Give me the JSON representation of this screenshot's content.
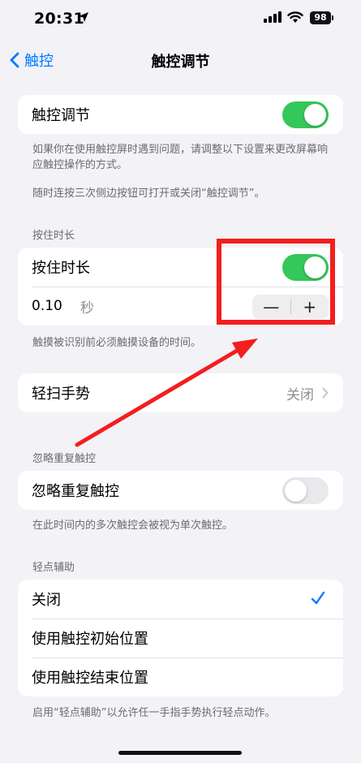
{
  "status": {
    "time": "20:31",
    "battery": "98"
  },
  "nav": {
    "back_label": "触控",
    "title": "触控调节"
  },
  "touch_accommodations": {
    "label": "触控调节",
    "enabled": true,
    "footnote_1": "如果你在使用触控屏时遇到问题，请调整以下设置来更改屏幕响应触控操作的方式。",
    "footnote_2": "随时连按三次侧边按钮可打开或关闭“触控调节”。"
  },
  "hold_duration": {
    "header": "按住时长",
    "label": "按住时长",
    "enabled": true,
    "value": "0.10",
    "unit": "秒",
    "minus": "—",
    "plus": "+",
    "footnote": "触摸被识别前必须触摸设备的时间。"
  },
  "swipe_gestures": {
    "label": "轻扫手势",
    "value": "关闭"
  },
  "ignore_repeat": {
    "header": "忽略重复触控",
    "label": "忽略重复触控",
    "enabled": false,
    "footnote": "在此时间内的多次触控会被视为单次触控。"
  },
  "tap_assistance": {
    "header": "轻点辅助",
    "options": [
      "关闭",
      "使用触控初始位置",
      "使用触控结束位置"
    ],
    "selected": "关闭",
    "footnote": "启用“轻点辅助”以允许任一手指手势执行轻点动作。"
  },
  "colors": {
    "accent": "#007aff",
    "toggle_on": "#34c759",
    "annotation": "#f31e1e"
  }
}
